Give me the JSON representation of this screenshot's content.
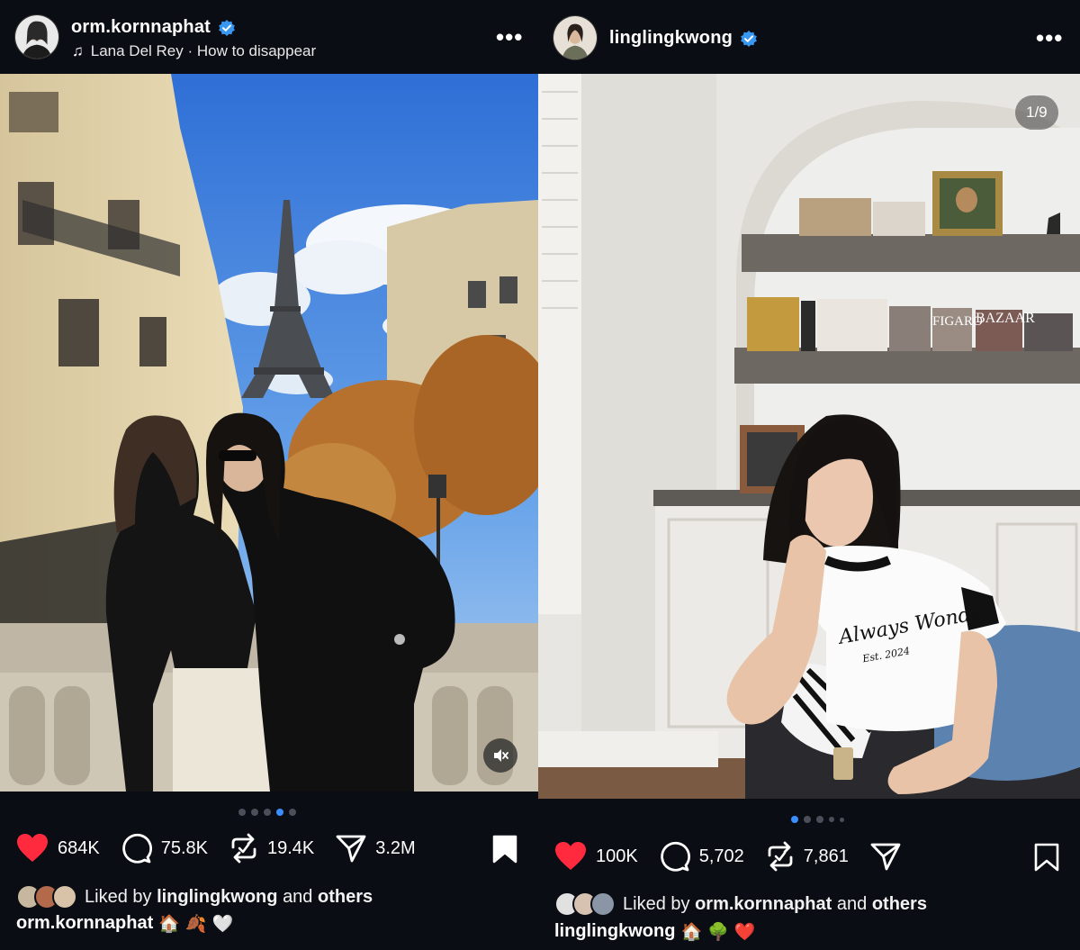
{
  "left_post": {
    "username": "orm.kornnaphat",
    "music": "Lana Del Rey · How to disappear",
    "more_label": "•••",
    "likes": "684K",
    "comments": "75.8K",
    "reposts": "19.4K",
    "shares": "3.2M",
    "liked_by_prefix": "Liked by",
    "liked_by_user": "linglingkwong",
    "liked_by_suffix": "and",
    "liked_by_others": "others",
    "caption_user": "orm.kornnaphat",
    "caption_emojis": [
      "🏠",
      "🍂",
      "🤍"
    ],
    "carousel_dots": 5,
    "active_dot": 3
  },
  "right_post": {
    "username": "linglingkwong",
    "more_label": "•••",
    "counter": "1/9",
    "shirt_text": "Always Wonder",
    "shirt_sub": "Est. 2024",
    "magazine_text_1": "BAZAAR",
    "magazine_text_2": "FIGARO",
    "likes": "100K",
    "comments": "5,702",
    "reposts": "7,861",
    "liked_by_prefix": "Liked by",
    "liked_by_user": "orm.kornnaphat",
    "liked_by_suffix": "and",
    "liked_by_others": "others",
    "caption_user": "linglingkwong",
    "caption_emojis": [
      "🏠",
      "🌳",
      "❤️"
    ],
    "carousel_dots": 5,
    "active_dot": 0
  },
  "colors": {
    "background": "#0b0d14",
    "verified": "#3897f0",
    "like_red": "#ff2a3d",
    "dot_active": "#3a8eff"
  },
  "icons": {
    "verified": "verified-badge-icon",
    "music": "music-note-icon",
    "like": "heart-icon",
    "comment": "comment-icon",
    "repost": "repost-icon",
    "share": "send-icon",
    "bookmark": "bookmark-icon",
    "mute": "speaker-muted-icon"
  }
}
